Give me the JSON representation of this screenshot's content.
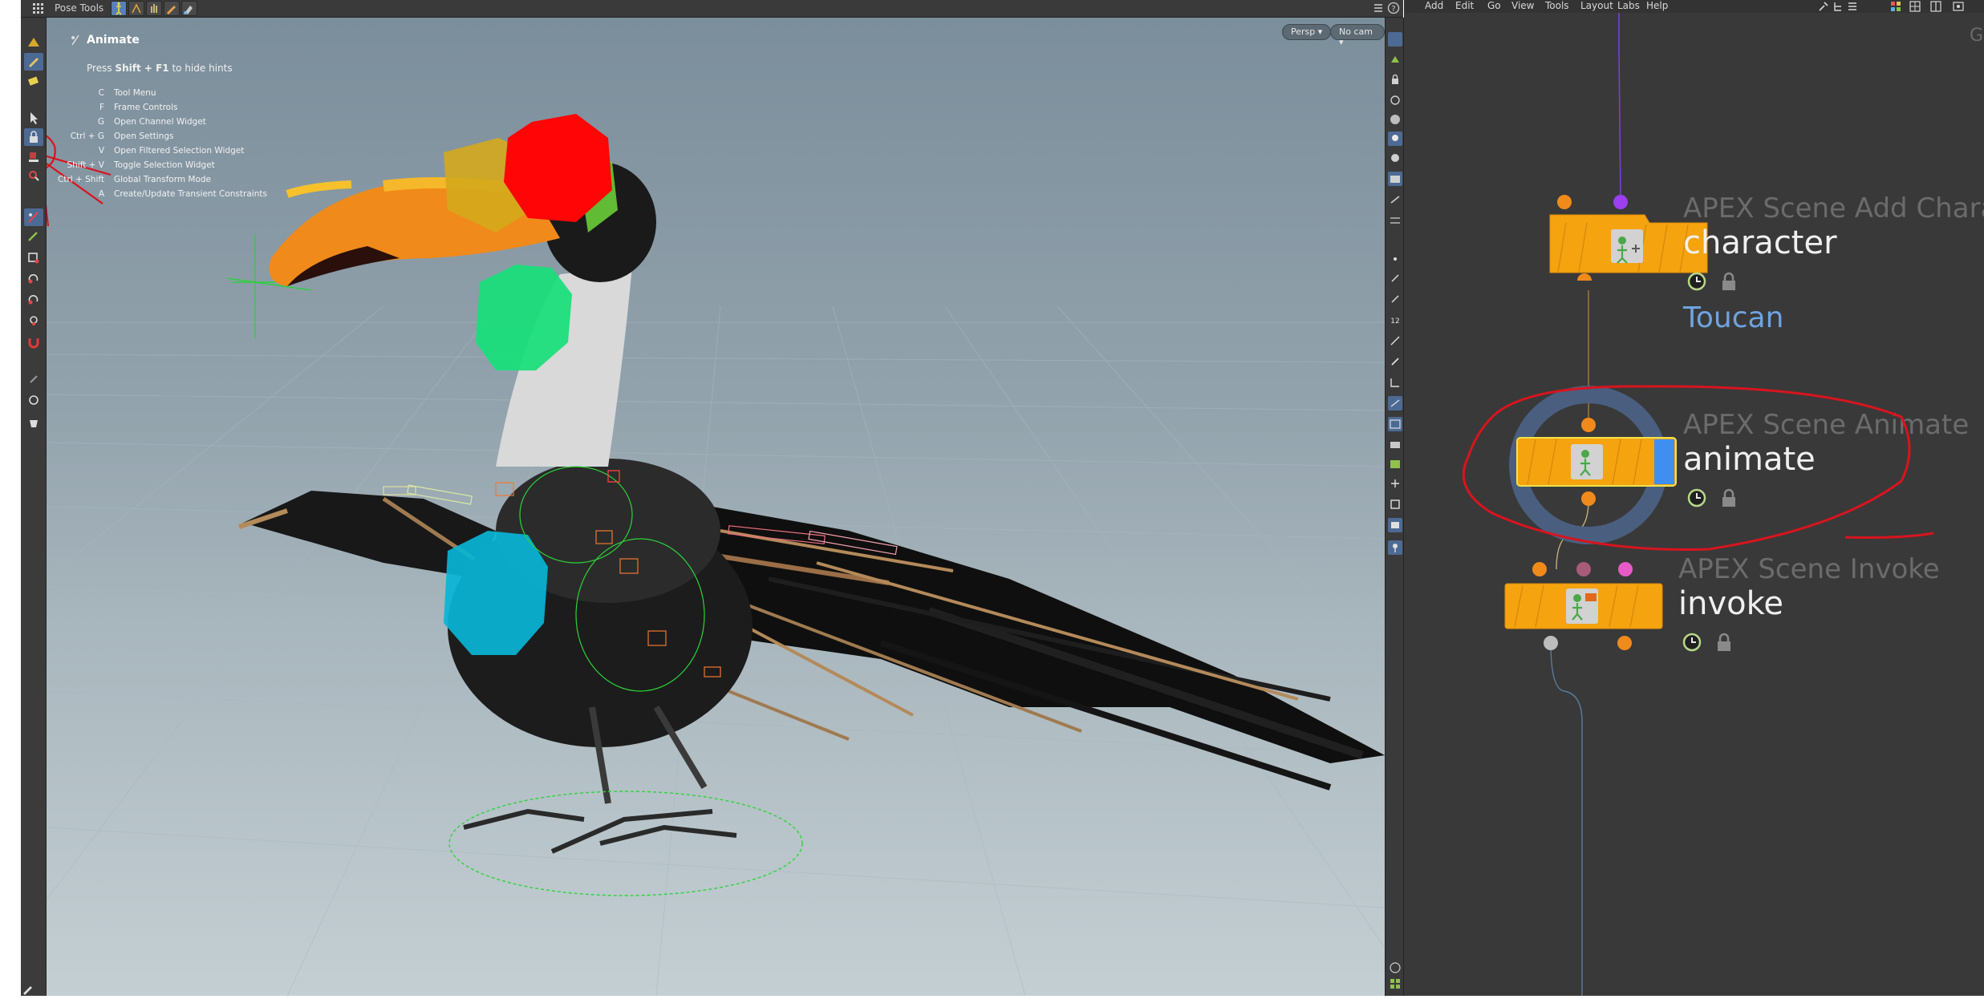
{
  "viewport_toolbar": {
    "title": "Pose Tools"
  },
  "viewport": {
    "hint_title": "Animate",
    "hint_press": "Press",
    "hint_keys": "Shift + F1",
    "hint_suffix": "to hide hints",
    "hotkeys": [
      {
        "key": "C",
        "label": "Tool Menu"
      },
      {
        "key": "F",
        "label": "Frame Controls"
      },
      {
        "key": "G",
        "label": "Open Channel Widget"
      },
      {
        "key": "Ctrl + G",
        "label": "Open Settings"
      },
      {
        "key": "V",
        "label": "Open Filtered Selection Widget"
      },
      {
        "key": "Shift + V",
        "label": "Toggle Selection Widget"
      },
      {
        "key": "Ctrl + Shift",
        "label": "Global Transform Mode"
      },
      {
        "key": "A",
        "label": "Create/Update Transient Constraints"
      }
    ],
    "persp_label": "Persp ▾",
    "cam_label": "No cam ▾"
  },
  "network_menu": [
    "Add",
    "Edit",
    "Go",
    "View",
    "Tools",
    "Layout",
    "Labs",
    "Help"
  ],
  "network_corner_text": "G",
  "nodes": [
    {
      "type": "APEX Scene Add Charac",
      "name": "character",
      "sub": "Toucan"
    },
    {
      "type": "APEX Scene Animate",
      "name": "animate"
    },
    {
      "type": "APEX Scene Invoke",
      "name": "invoke"
    }
  ],
  "colors": {
    "node_orange": "#f5a30f",
    "node_selected_outline": "#f3e24a",
    "display_flag_blue": "#3f8ff0",
    "ring_blue": "#4a5f80",
    "annotation_red": "#d8141e",
    "wire_purple": "#7a3fd6",
    "dot_purple": "#9b3ff0",
    "dot_pink": "#e65bc8",
    "dot_mauve": "#a85c7a",
    "dot_grey": "#bdbdbd"
  },
  "icons": {
    "clock": "clock-icon",
    "lock": "lock-icon"
  }
}
